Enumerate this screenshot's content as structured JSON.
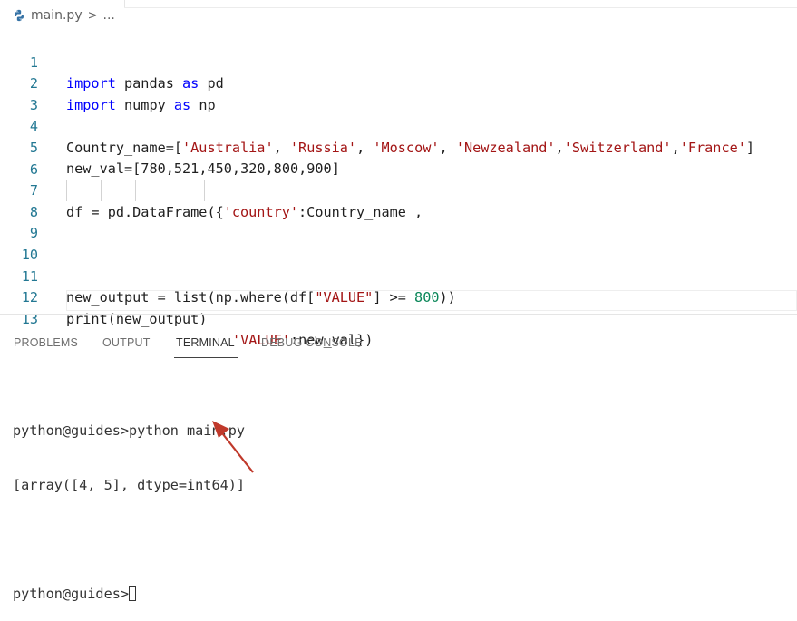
{
  "breadcrumb": {
    "file": "main.py",
    "separator": ">",
    "ellipsis": "..."
  },
  "editor": {
    "lines": [
      {
        "n": "1"
      },
      {
        "n": "2"
      },
      {
        "n": "3"
      },
      {
        "n": "4"
      },
      {
        "n": "5"
      },
      {
        "n": "6"
      },
      {
        "n": "7"
      },
      {
        "n": "8"
      },
      {
        "n": "9"
      },
      {
        "n": "10"
      },
      {
        "n": "11"
      },
      {
        "n": "12"
      },
      {
        "n": "13"
      }
    ],
    "code": {
      "l1": {
        "kw1": "import",
        "mid": " pandas ",
        "kw2": "as",
        "tail": " pd"
      },
      "l2": {
        "kw1": "import",
        "mid": " numpy ",
        "kw2": "as",
        "tail": " np"
      },
      "l4": {
        "head": "Country_name=[",
        "s1": "'Australia'",
        "c1": ", ",
        "s2": "'Russia'",
        "c2": ", ",
        "s3": "'Moscow'",
        "c3": ", ",
        "s4": "'Newzealand'",
        "c4": ",",
        "s5": "'Switzerland'",
        "c5": ",",
        "s6": "'France'",
        "tail": "]"
      },
      "l5": {
        "head": "new_val=[",
        "n1": "780",
        "n2": "521",
        "n3": "450",
        "n4": "320",
        "n5": "800",
        "n6": "900",
        "comma": ",",
        "tail": "]"
      },
      "l7": {
        "head": "df = pd.DataFrame({",
        "s1": "'country'",
        "tail": ":Country_name ,"
      },
      "l8": {
        "s1": "'VALUE'",
        "tail": ":new_val})"
      },
      "l11": {
        "head": "new_output = list(np.where(df[",
        "s1": "\"VALUE\"",
        "mid": "] >= ",
        "n1": "800",
        "tail": "))"
      },
      "l12": {
        "head": "print(new_output)"
      }
    }
  },
  "panel": {
    "tabs": [
      {
        "label": "PROBLEMS"
      },
      {
        "label": "OUTPUT"
      },
      {
        "label": "TERMINAL",
        "active": true
      },
      {
        "label": "DEBUG CONSOLE"
      }
    ]
  },
  "terminal": {
    "line1": "python@guides>python main.py",
    "line2": "[array([4, 5], dtype=int64)]",
    "line3": "",
    "prompt": "python@guides>"
  },
  "colors": {
    "keyword": "#0000ff",
    "string": "#a31515",
    "number": "#098658",
    "line_number": "#237893",
    "arrow": "#c0392b"
  },
  "icons": {
    "file": "python-icon",
    "annotation": "red-arrow-icon"
  }
}
